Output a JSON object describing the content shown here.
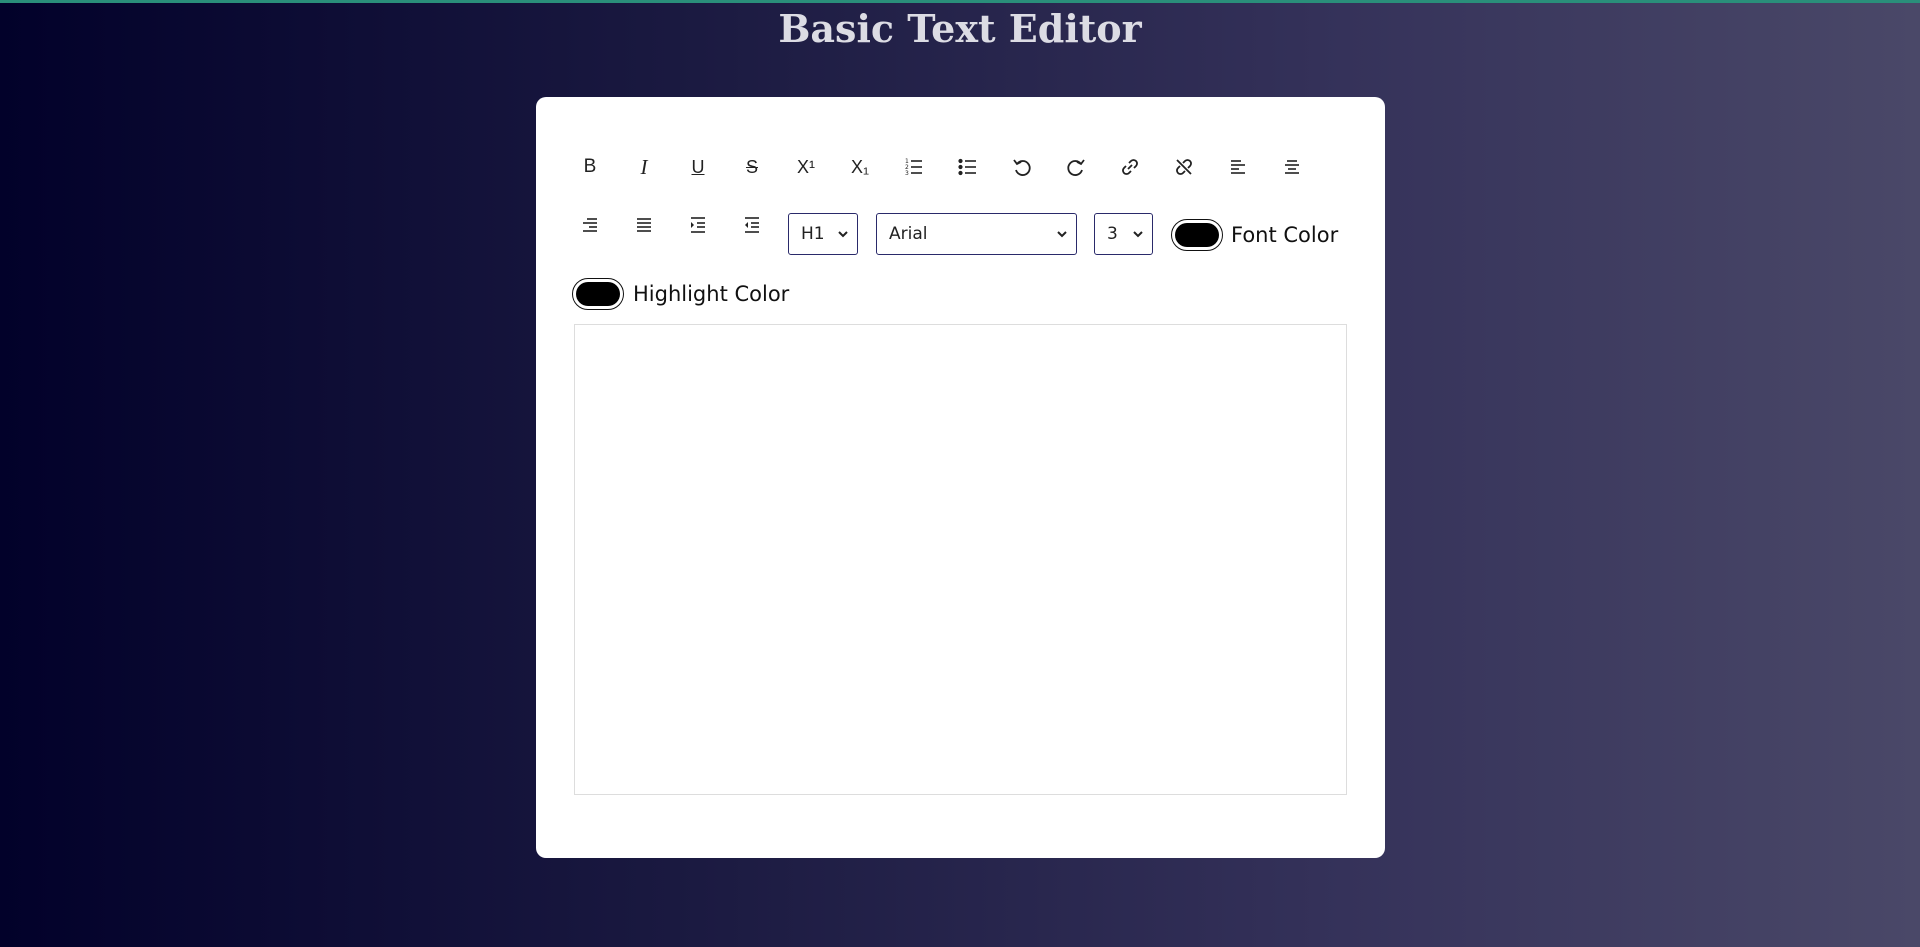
{
  "page": {
    "title": "Basic Text Editor"
  },
  "toolbar": {
    "buttons": [
      {
        "icon": "bold-icon",
        "label": "B"
      },
      {
        "icon": "italic-icon",
        "label": "I"
      },
      {
        "icon": "underline-icon",
        "label": "U"
      },
      {
        "icon": "strikethrough-icon",
        "label": "S"
      },
      {
        "icon": "superscript-icon",
        "label": "X¹"
      },
      {
        "icon": "subscript-icon",
        "label": "X₁"
      },
      {
        "icon": "ordered-list-icon"
      },
      {
        "icon": "unordered-list-icon"
      },
      {
        "icon": "undo-icon"
      },
      {
        "icon": "redo-icon"
      },
      {
        "icon": "link-icon"
      },
      {
        "icon": "unlink-icon"
      },
      {
        "icon": "align-left-icon"
      },
      {
        "icon": "align-center-icon"
      },
      {
        "icon": "align-right-icon"
      },
      {
        "icon": "justify-icon"
      },
      {
        "icon": "indent-icon"
      },
      {
        "icon": "outdent-icon"
      }
    ],
    "heading_select": {
      "value": "H1"
    },
    "font_select": {
      "value": "Arial"
    },
    "size_select": {
      "value": "3"
    },
    "font_color": {
      "label": "Font Color",
      "value": "#000000"
    },
    "highlight_color": {
      "label": "Highlight Color",
      "value": "#000000"
    }
  },
  "editor": {
    "content": ""
  }
}
